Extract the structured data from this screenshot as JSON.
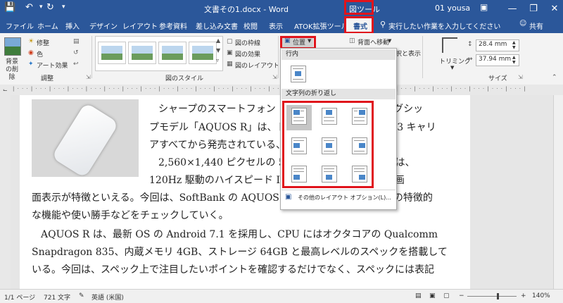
{
  "titlebar": {
    "document_title": "文書その1.docx - Word",
    "contextual_tab_group": "図ツール",
    "user": "01 yousa",
    "undo_icon": "undo-icon",
    "redo_icon": "redo-icon",
    "save_icon": "save-icon"
  },
  "tabs": {
    "items": [
      "ファイル",
      "ホーム",
      "挿入",
      "デザイン",
      "レイアウト",
      "参考資料",
      "差し込み文書",
      "校閲",
      "表示",
      "ATOK拡張ツール",
      "書式"
    ],
    "active": "書式",
    "tellme": "実行したい作業を入力してください",
    "share": "共有"
  },
  "ribbon": {
    "remove_bg": "背景の削除",
    "correct": "修整",
    "color": "色",
    "artistic": "アート効果",
    "adjust_group": "調整",
    "styles_group": "図のスタイル",
    "picture_border": "図の枠線",
    "picture_effects": "図の効果",
    "picture_layout": "図のレイアウト",
    "position": "位置",
    "send_backward": "背面へ移動",
    "wrap_text_fragment": "択と表示",
    "crop": "トリミング",
    "height": "28.4 mm",
    "width": "37.94 mm",
    "size_group": "サイズ"
  },
  "dropdown": {
    "inline_header": "行内",
    "wrap_header": "文字列の折り返し",
    "more_options": "その他のレイアウト オプション(L)..."
  },
  "document": {
    "lines": [
      "シャープのスマートフォン「AQUOS R」は、フラッグシッ",
      "プモデル「AQUOS R」は、ドコモ、au、SoftBankの 3 キャリ",
      "アすべてから発売されている、ハイスペックな製品だ。",
      "2,560×1,440 ピクセルの 5.3 インチディスプレイには、",
      "120Hz 駆動のハイスピード IGZO を搭載し、卓越した画",
      "面表示が特徴といえる。今回は、SoftBank の AQUOS R を使って、AQUOS R の特徴的",
      "な機能や使い勝手などをチェックしていく。",
      "AQUOS R は、最新 OS の Android 7.1 を採用し、CPU にはオクタコアの Qualcomm",
      "Snapdragon 835、内蔵メモリ 4GB、ストレージ 64GB と最高レベルのスペックを搭載して",
      "いる。今回は、スペック上で注目したいポイントを確認するだけでなく、スペックには表記"
    ]
  },
  "status": {
    "page": "1/1 ページ",
    "words": "721 文字",
    "language": "英語 (米国)",
    "zoom": "140%"
  },
  "colors": {
    "word_blue": "#2b579a",
    "highlight_red": "#e0141c"
  }
}
